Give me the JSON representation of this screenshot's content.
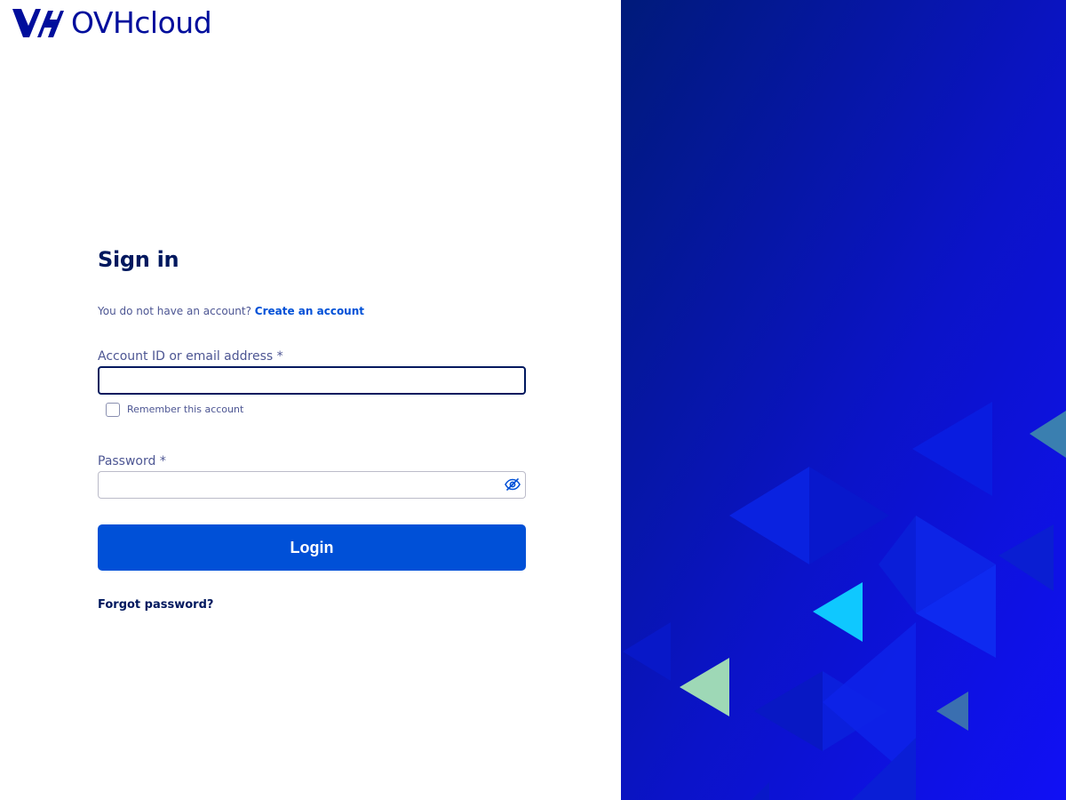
{
  "brand": {
    "name": "OVHcloud",
    "color": "#000e9c"
  },
  "signin": {
    "title": "Sign in",
    "no_account_text": "You do not have an account?",
    "create_account_link": "Create an account",
    "account_label": "Account ID or email address *",
    "account_value": "",
    "remember_label": "Remember this account",
    "remember_checked": false,
    "password_label": "Password *",
    "password_value": "",
    "password_toggle_icon": "eye-slash-icon",
    "login_button": "Login",
    "forgot_password": "Forgot password?"
  },
  "colors": {
    "primary_button": "#0050d7",
    "heading": "#00185e",
    "label": "#4d5693",
    "hero_gradient_start": "#001a7a",
    "hero_gradient_end": "#1010f5"
  }
}
